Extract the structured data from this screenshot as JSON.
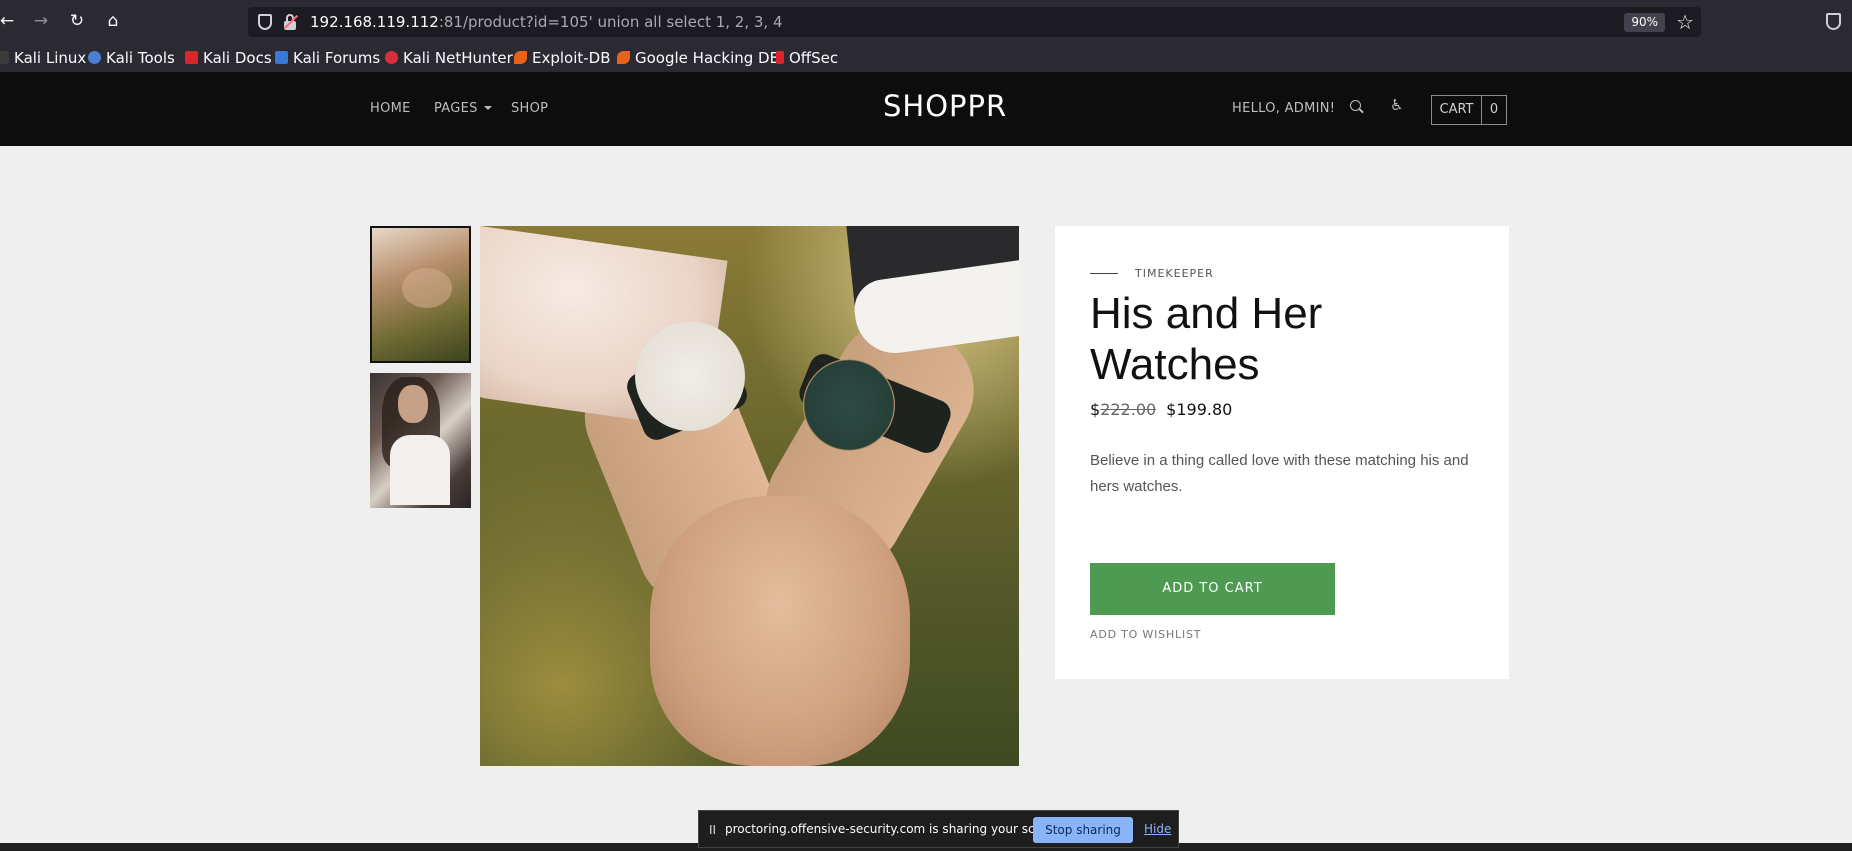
{
  "browser": {
    "url_host": "192.168.119.112",
    "url_path": ":81/product?id=105' union all select 1, 2, 3, 4",
    "zoom": "90%",
    "bookmarks": [
      "Kali Linux",
      "Kali Tools",
      "Kali Docs",
      "Kali Forums",
      "Kali NetHunter",
      "Exploit-DB",
      "Google Hacking DB",
      "OffSec"
    ]
  },
  "site": {
    "nav": {
      "home": "HOME",
      "pages": "PAGES",
      "shop": "SHOP"
    },
    "brand": "SHOPPR",
    "greeting": "HELLO, ADMIN!",
    "cart_label": "CART",
    "cart_count": "0"
  },
  "product": {
    "category": "TIMEKEEPER",
    "title": "His and Her Watches",
    "currency": "$",
    "old_price": "222.00",
    "new_price": "$199.80",
    "description": "Believe in a thing called love with these matching his and hers watches.",
    "add_to_cart": "ADD TO CART",
    "add_to_wishlist": "ADD TO WISHLIST"
  },
  "share_bar": {
    "pause": "II",
    "message": "proctoring.offensive-security.com is sharing your screen.",
    "stop": "Stop sharing",
    "hide": "Hide"
  },
  "colors": {
    "add_to_cart": "#4e9a52",
    "header_bg": "#0d0d0d",
    "page_bg": "#efefef"
  }
}
